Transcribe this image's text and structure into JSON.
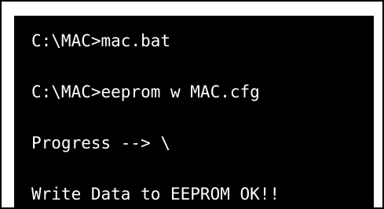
{
  "console": {
    "background": "#000000",
    "text_color": "#ffffff",
    "lines": [
      "C:\\MAC>mac.bat",
      "C:\\MAC>eeprom w MAC.cfg",
      "Progress --> \\",
      "Write Data to EEPROM OK!!"
    ]
  }
}
